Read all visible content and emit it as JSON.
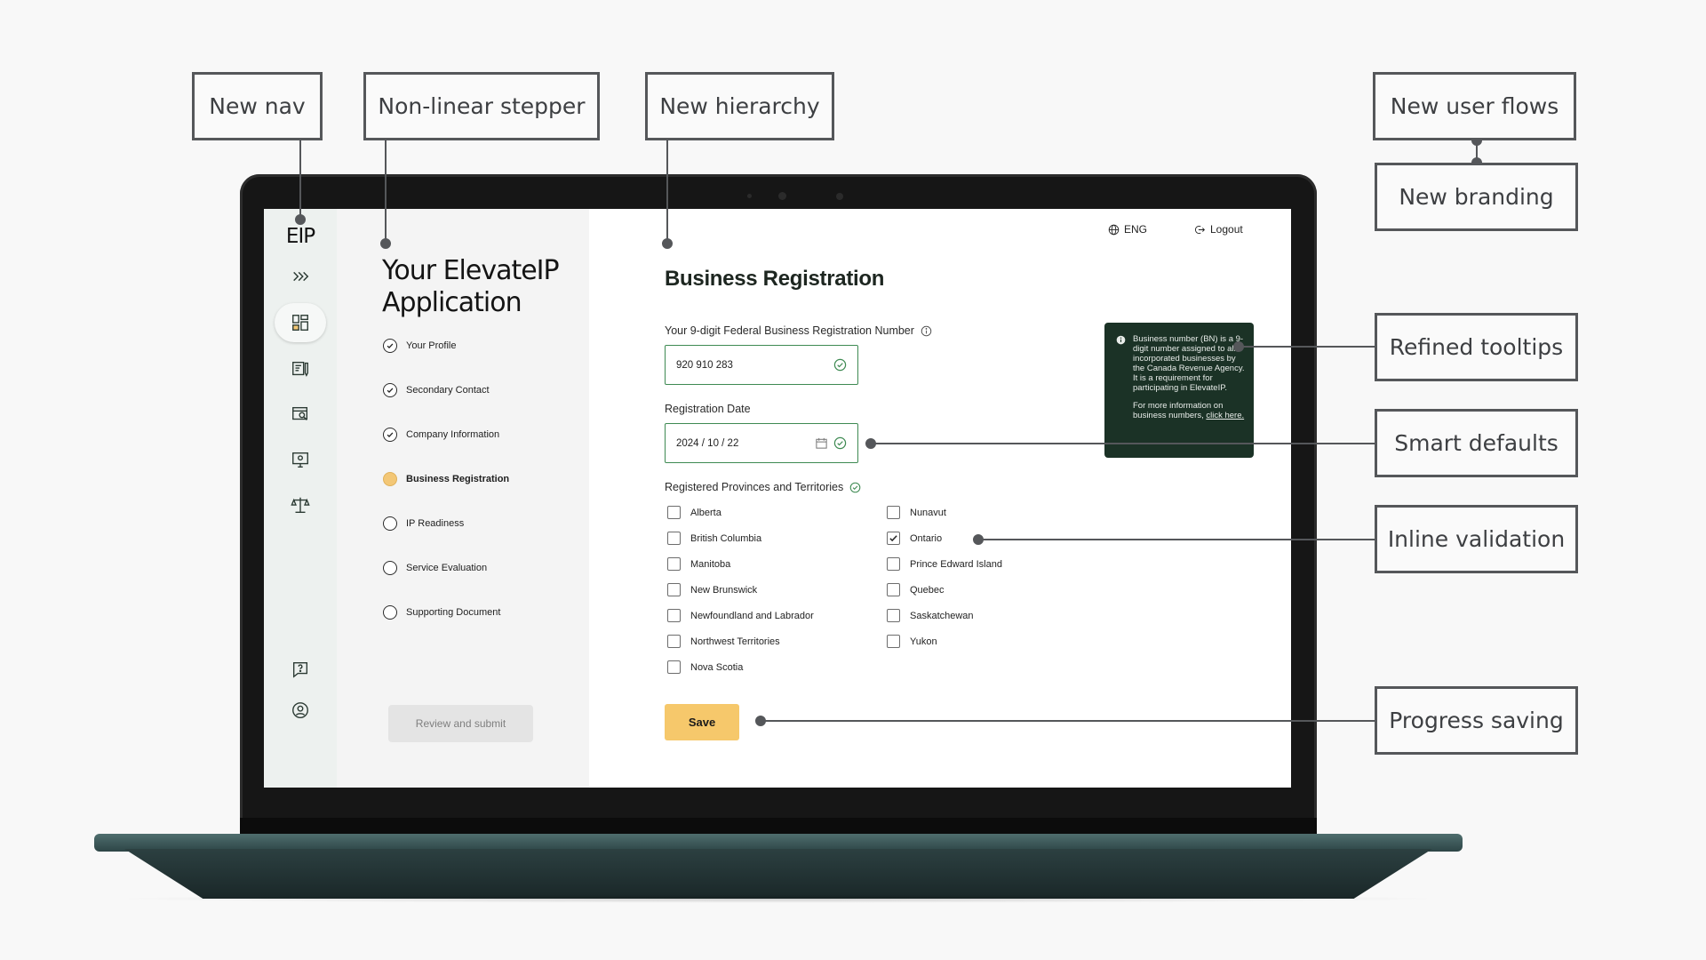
{
  "annotations": {
    "new_nav": "New nav",
    "stepper": "Non-linear stepper",
    "hierarchy": "New hierarchy",
    "user_flows": "New user flows",
    "branding": "New branding",
    "tooltips": "Refined tooltips",
    "defaults": "Smart defaults",
    "validation": "Inline validation",
    "saving": "Progress saving"
  },
  "rail": {
    "logo": "EIP",
    "icons": [
      "expand-icon",
      "dashboard-icon",
      "application-icon",
      "search-document-icon",
      "monitor-icon",
      "scales-icon",
      "help-icon",
      "account-icon"
    ]
  },
  "stepper": {
    "title": "Your ElevateIP Application",
    "steps": [
      {
        "label": "Your Profile",
        "status": "complete"
      },
      {
        "label": "Secondary Contact",
        "status": "complete"
      },
      {
        "label": "Company Information",
        "status": "complete"
      },
      {
        "label": "Business Registration",
        "status": "current"
      },
      {
        "label": "IP Readiness",
        "status": "incomplete"
      },
      {
        "label": "Service Evaluation",
        "status": "incomplete"
      },
      {
        "label": "Supporting Document",
        "status": "incomplete"
      }
    ],
    "review_label": "Review and submit"
  },
  "topbar": {
    "language": "ENG",
    "logout": "Logout"
  },
  "form": {
    "title": "Business Registration",
    "bn_label": "Your 9-digit Federal Business Registration Number",
    "bn_value": "920 910 283",
    "date_label": "Registration Date",
    "date_value": "2024 / 10 / 22",
    "provinces_label": "Registered Provinces and Territories",
    "provinces_left": [
      {
        "label": "Alberta",
        "checked": false
      },
      {
        "label": "British Columbia",
        "checked": false
      },
      {
        "label": "Manitoba",
        "checked": false
      },
      {
        "label": "New Brunswick",
        "checked": false
      },
      {
        "label": "Newfoundland and Labrador",
        "checked": false
      },
      {
        "label": "Northwest Territories",
        "checked": false
      },
      {
        "label": "Nova Scotia",
        "checked": false
      }
    ],
    "provinces_right": [
      {
        "label": "Nunavut",
        "checked": false
      },
      {
        "label": "Ontario",
        "checked": true
      },
      {
        "label": "Prince Edward Island",
        "checked": false
      },
      {
        "label": "Quebec",
        "checked": false
      },
      {
        "label": "Saskatchewan",
        "checked": false
      },
      {
        "label": "Yukon",
        "checked": false
      }
    ],
    "save_label": "Save"
  },
  "tooltip": {
    "body": "Business number (BN) is a 9-digit number assigned to all incorporated businesses by the Canada Revenue Agency. It is a requirement for participating in ElevateIP.",
    "more": "For more information on business numbers,",
    "link": "click here."
  },
  "colors": {
    "accent_yellow": "#f6c86b",
    "valid_green": "#3e8a52",
    "tooltip_bg": "#1b3226",
    "rail_bg": "#edf1ef"
  }
}
